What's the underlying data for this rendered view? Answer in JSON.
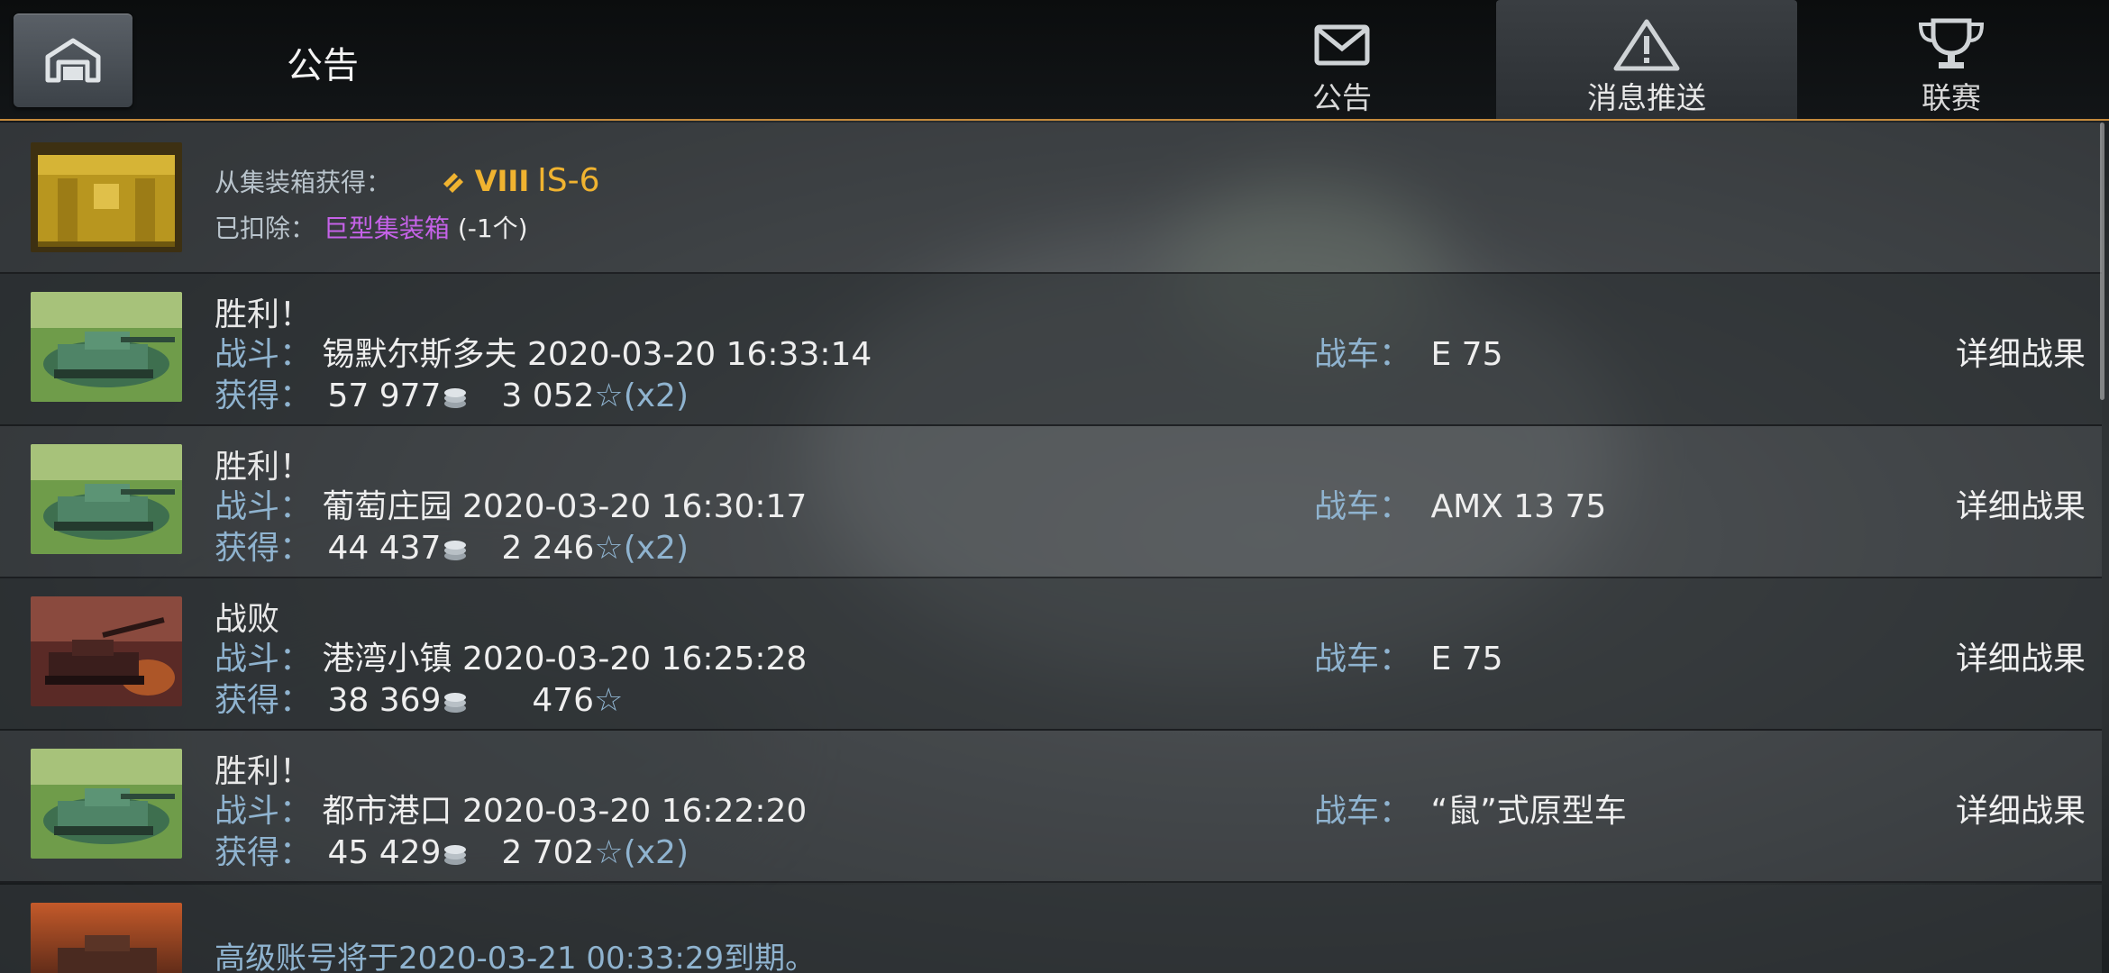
{
  "header": {
    "title": "公告",
    "tabs": [
      {
        "label": "公告",
        "icon": "envelope-icon",
        "active": false
      },
      {
        "label": "消息推送",
        "icon": "warning-triangle-icon",
        "active": true
      },
      {
        "label": "联赛",
        "icon": "trophy-icon",
        "active": false
      }
    ]
  },
  "reward_row": {
    "obtained_label": "从集装箱获得：",
    "tier": "VIII",
    "tank": "IS-6",
    "deducted_label": "已扣除：",
    "deducted_item": "巨型集装箱",
    "deducted_count": "(-1个)"
  },
  "labels": {
    "battle": "战斗：",
    "earned": "获得：",
    "vehicle": "战车：",
    "details": "详细战果"
  },
  "battles": [
    {
      "result": "胜利！",
      "map": "锡默尔斯多夫",
      "time": "2020-03-20 16:33:14",
      "credits": "57 977",
      "xp": "3 052",
      "mult": "(x2)",
      "vehicle": "E 75",
      "thumb": "victory"
    },
    {
      "result": "胜利！",
      "map": "葡萄庄园",
      "time": "2020-03-20 16:30:17",
      "credits": "44 437",
      "xp": "2 246",
      "mult": "(x2)",
      "vehicle": "AMX 13 75",
      "thumb": "victory"
    },
    {
      "result": "战败",
      "map": "港湾小镇",
      "time": "2020-03-20 16:25:28",
      "credits": "38 369",
      "xp": "476",
      "mult": "",
      "vehicle": "E 75",
      "thumb": "defeat"
    },
    {
      "result": "胜利！",
      "map": "都市港口",
      "time": "2020-03-20 16:22:20",
      "credits": "45 429",
      "xp": "2 702",
      "mult": "(x2)",
      "vehicle": "“鼠”式原型车",
      "thumb": "victory"
    }
  ],
  "premium_row": {
    "text": "高级账号将于2020-03-21 00:33:29到期。"
  },
  "colors": {
    "accent_border": "#c58a3c",
    "label_blue": "#8fb3cf",
    "purple": "#c562e8",
    "gold": "#f0b330"
  }
}
